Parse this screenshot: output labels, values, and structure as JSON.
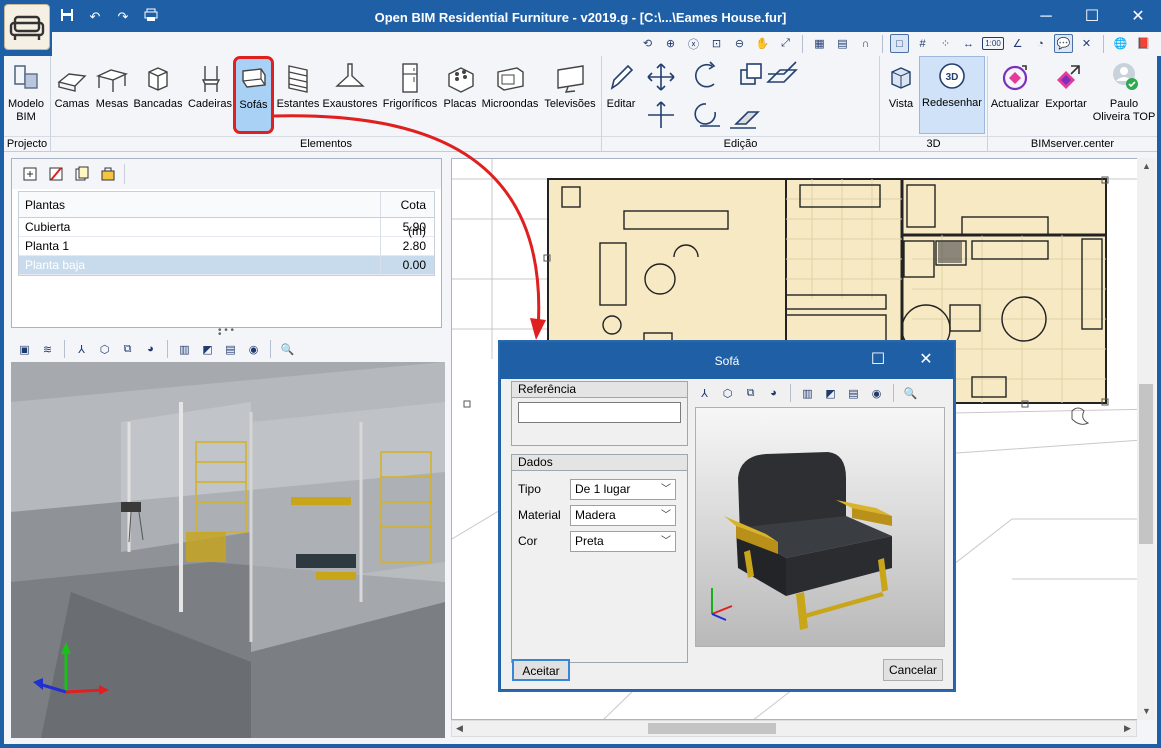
{
  "window": {
    "title": "Open BIM Residential Furniture - v2019.g - [C:\\...\\Eames House.fur]",
    "minimize_icon": "─",
    "maximize_icon": "☐",
    "close_icon": "✕"
  },
  "quick_access": [
    "save-icon",
    "undo-icon",
    "redo-icon",
    "print-icon"
  ],
  "toolbar_strip": {
    "scale_label": "1:00"
  },
  "ribbon": {
    "project_group": "Projecto",
    "elements_group": "Elementos",
    "edit_group": "Edição",
    "view3d_group": "3D",
    "bimserver_group": "BIMserver.center",
    "buttons": {
      "modelo_bim": "Modelo\nBIM",
      "camas": "Camas",
      "mesas": "Mesas",
      "bancadas": "Bancadas",
      "cadeiras": "Cadeiras",
      "sofas": "Sofás",
      "estantes": "Estantes",
      "exaustores": "Exaustores",
      "frigorificos": "Frigoríficos",
      "placas": "Placas",
      "microondas": "Microondas",
      "televisoes": "Televisões",
      "editar": "Editar",
      "vista": "Vista",
      "redesenhar": "Redesenhar",
      "actualizar": "Actualizar",
      "exportar": "Exportar",
      "user": "Paulo\nOliveira TOP"
    },
    "redesenhar_badge": "3D"
  },
  "floors": {
    "col_name": "Plantas",
    "col_level": "Cota (m)",
    "rows": [
      {
        "name": "Cubierta",
        "level": "5.90"
      },
      {
        "name": "Planta 1",
        "level": "2.80"
      },
      {
        "name": "Planta baja",
        "level": "0.00"
      }
    ]
  },
  "dialog": {
    "title": "Sofá",
    "ref_header": "Referência",
    "ref_value": "",
    "dados_header": "Dados",
    "fields": [
      {
        "label": "Tipo",
        "value": "De 1 lugar"
      },
      {
        "label": "Material",
        "value": "Madera"
      },
      {
        "label": "Cor",
        "value": "Preta"
      }
    ],
    "ok": "Aceitar",
    "cancel": "Cancelar"
  },
  "colors": {
    "titlebar": "#1f5fa6",
    "ribbon_bg": "#f3f5f9",
    "selected_button": "#a9d0f5",
    "highlight_red": "#e0201e",
    "plan_fill": "#f6e9c4"
  }
}
